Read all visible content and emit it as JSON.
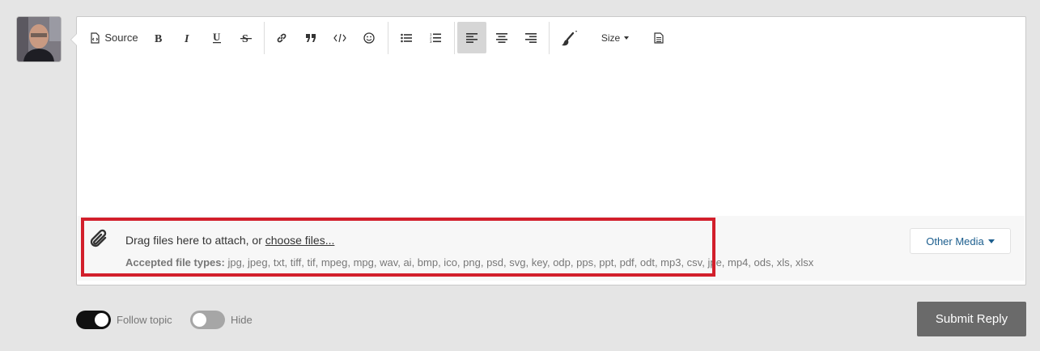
{
  "toolbar": {
    "source_label": "Source",
    "size_label": "Size"
  },
  "attachments": {
    "drag_text": "Drag files here to attach, or ",
    "choose_link": "choose files...",
    "accepted_label": "Accepted file types:",
    "accepted_types": "jpg, jpeg, txt, tiff, tif, mpeg, mpg, wav, ai, bmp, ico, png, psd, svg, key, odp, pps, ppt, pdf, odt, mp3, csv, jpe, mp4, ods, xls, xlsx",
    "other_media_label": "Other Media"
  },
  "options": {
    "follow_label": "Follow topic",
    "follow_on": true,
    "hide_label": "Hide",
    "hide_on": false
  },
  "submit_label": "Submit Reply",
  "colors": {
    "highlight": "#d21f2b",
    "link": "#1c5e8e",
    "submit_bg": "#6a6a6a",
    "active_button": "#d6d6d6"
  }
}
